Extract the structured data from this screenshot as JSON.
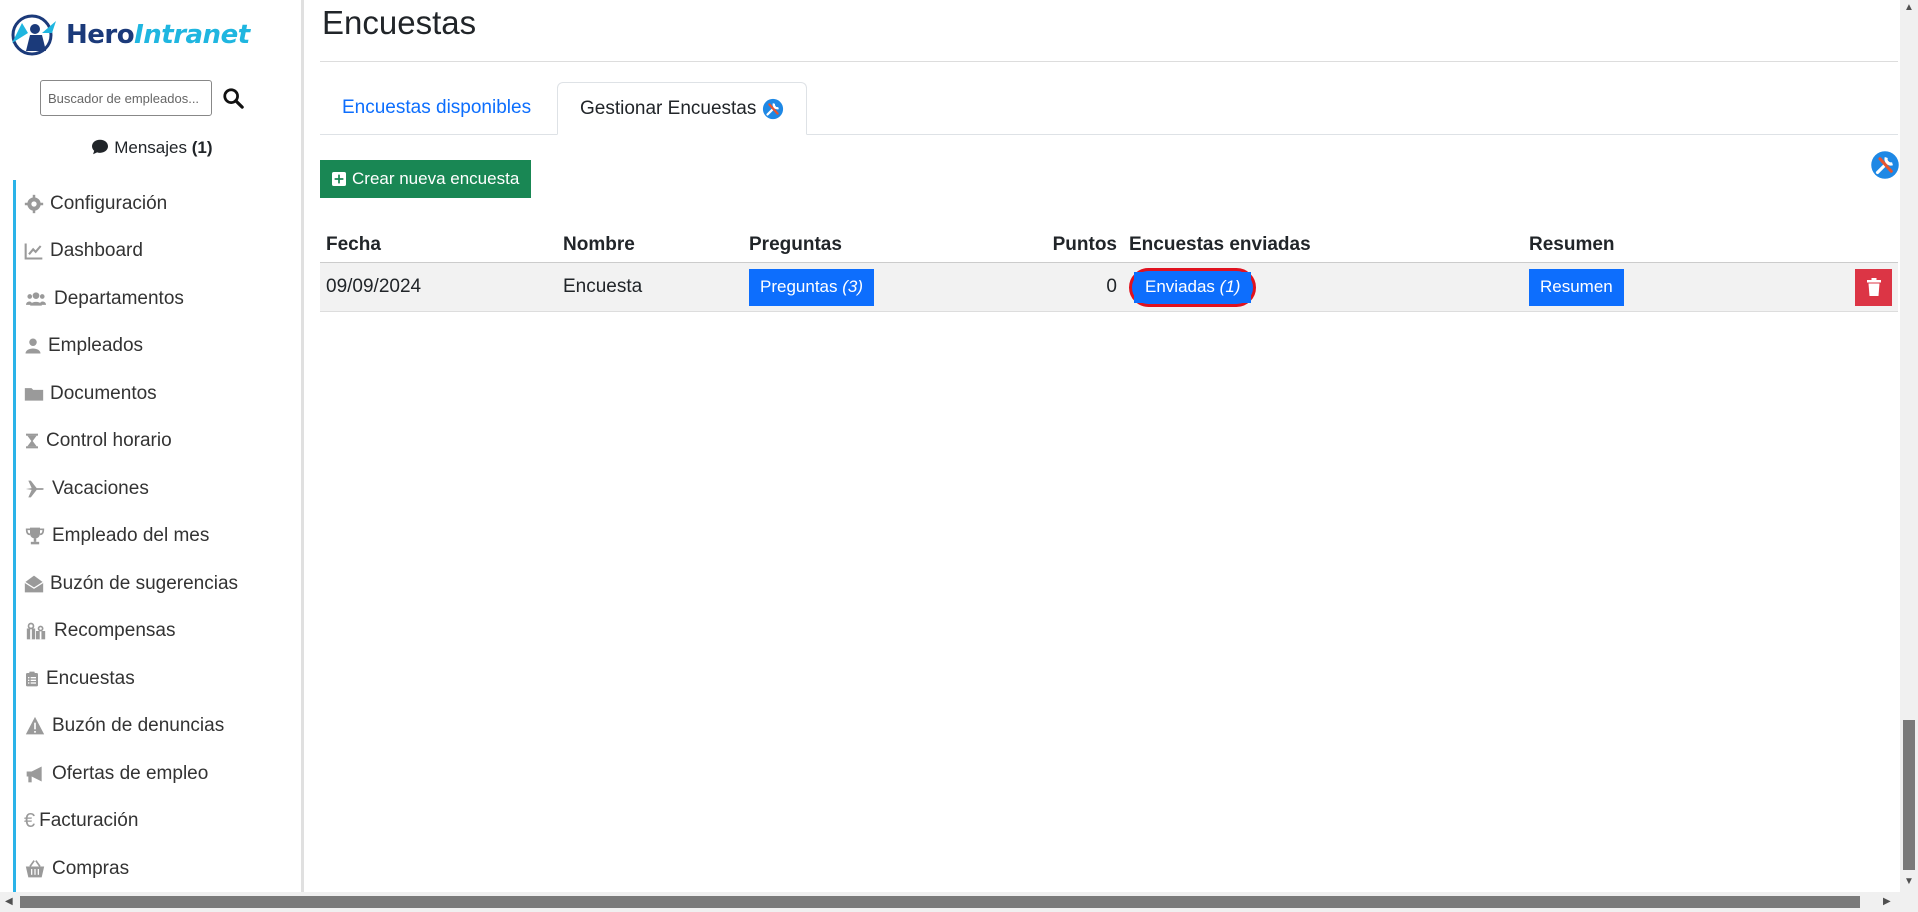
{
  "brand": {
    "name_part1": "Hero",
    "name_part2": "Intranet"
  },
  "search": {
    "placeholder": "Buscador de empleados..."
  },
  "messages": {
    "label": "Mensajes",
    "count": "(1)"
  },
  "sidebar": {
    "items": [
      {
        "label": "Configuración",
        "icon": "gear-icon"
      },
      {
        "label": "Dashboard",
        "icon": "chart-line-icon"
      },
      {
        "label": "Departamentos",
        "icon": "users-icon"
      },
      {
        "label": "Empleados",
        "icon": "user-icon"
      },
      {
        "label": "Documentos",
        "icon": "folder-icon"
      },
      {
        "label": "Control horario",
        "icon": "hourglass-icon"
      },
      {
        "label": "Vacaciones",
        "icon": "plane-icon"
      },
      {
        "label": "Empleado del mes",
        "icon": "trophy-icon"
      },
      {
        "label": "Buzón de sugerencias",
        "icon": "envelope-open-icon"
      },
      {
        "label": "Recompensas",
        "icon": "gifts-icon"
      },
      {
        "label": "Encuestas",
        "icon": "clipboard-list-icon"
      },
      {
        "label": "Buzón de denuncias",
        "icon": "warning-icon"
      },
      {
        "label": "Ofertas de empleo",
        "icon": "megaphone-icon"
      },
      {
        "label": "Facturación",
        "icon": "euro-icon"
      },
      {
        "label": "Compras",
        "icon": "basket-icon"
      }
    ]
  },
  "page": {
    "title": "Encuestas"
  },
  "tabs": [
    {
      "label": "Encuestas disponibles",
      "active": false
    },
    {
      "label": "Gestionar Encuestas",
      "active": true
    }
  ],
  "actions": {
    "create_label": "Crear nueva encuesta"
  },
  "table": {
    "headers": [
      "Fecha",
      "Nombre",
      "Preguntas",
      "Puntos",
      "Encuestas enviadas",
      "Resumen"
    ],
    "rows": [
      {
        "fecha": "09/09/2024",
        "nombre": "Encuesta",
        "preguntas_label": "Preguntas",
        "preguntas_count": "(3)",
        "puntos": "0",
        "enviadas_label": "Enviadas",
        "enviadas_count": "(1)",
        "resumen_label": "Resumen"
      }
    ]
  },
  "colors": {
    "primary": "#0d6efd",
    "success": "#198754",
    "danger": "#dc3545",
    "accent": "#2ab3e8",
    "highlight": "#e0121f"
  }
}
